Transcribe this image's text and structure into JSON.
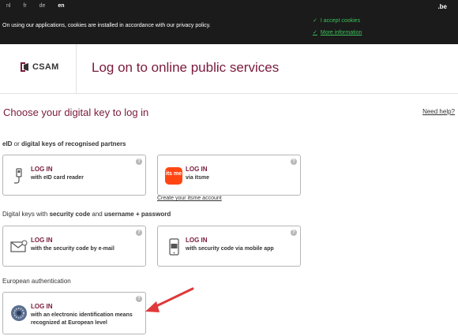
{
  "topbar": {
    "languages": [
      "nl",
      "fr",
      "de",
      "en"
    ],
    "active_language": "en",
    "domain": ".be",
    "cookie_text": "On using our applications, cookies are installed in accordance with our privacy policy.",
    "accept_cookies": "I accept cookies",
    "more_information": "More information"
  },
  "header": {
    "logo_text": "CSAM",
    "title": "Log on to online public services"
  },
  "main": {
    "choose_title": "Choose your digital key to log in",
    "need_help": "Need help?",
    "section1": {
      "pre": "eID",
      "mid": " or ",
      "post": "digital keys of recognised partners"
    },
    "section2": {
      "a": "Digital keys with ",
      "b": "security code",
      "c": " and ",
      "d": "username + password"
    },
    "section3": "European authentication",
    "cards": [
      {
        "title": "LOG IN",
        "subtitle": "with eID card reader",
        "icon": "card-reader-icon"
      },
      {
        "title": "LOG IN",
        "subtitle": "via itsme",
        "icon": "itsme-icon"
      },
      {
        "title": "LOG IN",
        "subtitle": "with the security code by e-mail",
        "icon": "envelope-icon"
      },
      {
        "title": "LOG IN",
        "subtitle": "with security code via mobile app",
        "icon": "mobile-app-icon"
      },
      {
        "title": "LOG IN",
        "subtitle": "with an electronic identification means recognized at European level",
        "icon": "eu-stars-icon"
      }
    ],
    "itsme_link": "Create your itsme account",
    "help_glyph": "?",
    "itsme_logo_text": "its me"
  },
  "colors": {
    "accent": "#7a1a3c",
    "cookie_green": "#39c25a",
    "topbar_bg": "#1b1b1b",
    "arrow": "#e0393a"
  }
}
